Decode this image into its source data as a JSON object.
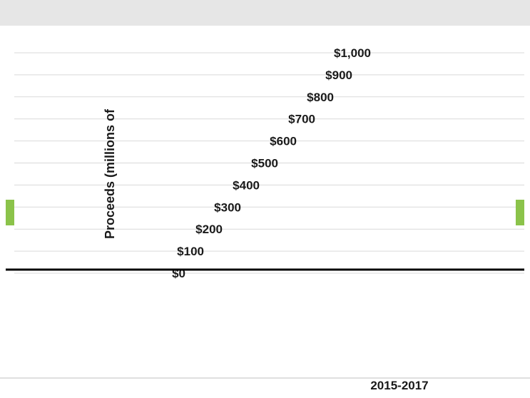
{
  "chart_data": {
    "type": "bar",
    "ylabel": "Proceeds (millions of",
    "yticks": [
      "$0",
      "$100",
      "$200",
      "$300",
      "$400",
      "$500",
      "$600",
      "$700",
      "$800",
      "$900",
      "$1,000"
    ],
    "ylim": [
      0,
      1000
    ],
    "legend_label": "2015-2017",
    "colors": {
      "bar": "#8bc34a",
      "axis": "#000000",
      "grid": "#d9d9d9",
      "band": "#7f7f7f"
    }
  }
}
